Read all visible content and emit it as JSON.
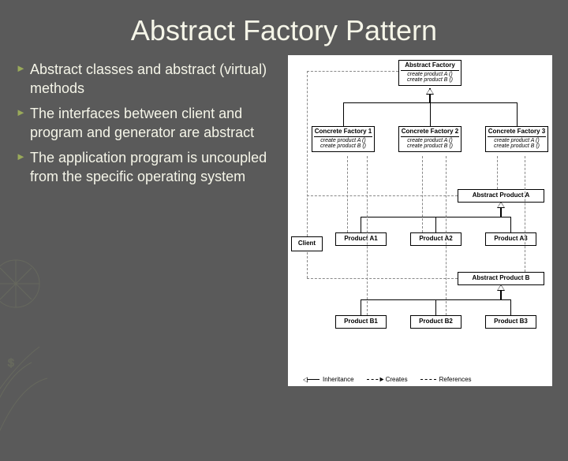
{
  "title": "Abstract Factory Pattern",
  "bullets": [
    "Abstract classes and abstract (virtual) methods",
    "The interfaces between client and program and generator are abstract",
    "The application program is uncoupled from the specific operating system"
  ],
  "diagram": {
    "abstract_factory": {
      "name": "Abstract Factory",
      "methods": "create product A ()\ncreate product B ()"
    },
    "concrete_factories": [
      {
        "name": "Concrete Factory 1",
        "methods": "create product A ()\ncreate product B ()"
      },
      {
        "name": "Concrete Factory 2",
        "methods": "create product A ()\ncreate product B ()"
      },
      {
        "name": "Concrete Factory 3",
        "methods": "create product A ()\ncreate product B ()"
      }
    ],
    "client": "Client",
    "abstract_products": [
      "Abstract Product A",
      "Abstract Product B"
    ],
    "products_a": [
      "Product A1",
      "Product A2",
      "Product A3"
    ],
    "products_b": [
      "Product B1",
      "Product B2",
      "Product B3"
    ],
    "legend": [
      "Inheritance",
      "Creates",
      "References"
    ]
  }
}
